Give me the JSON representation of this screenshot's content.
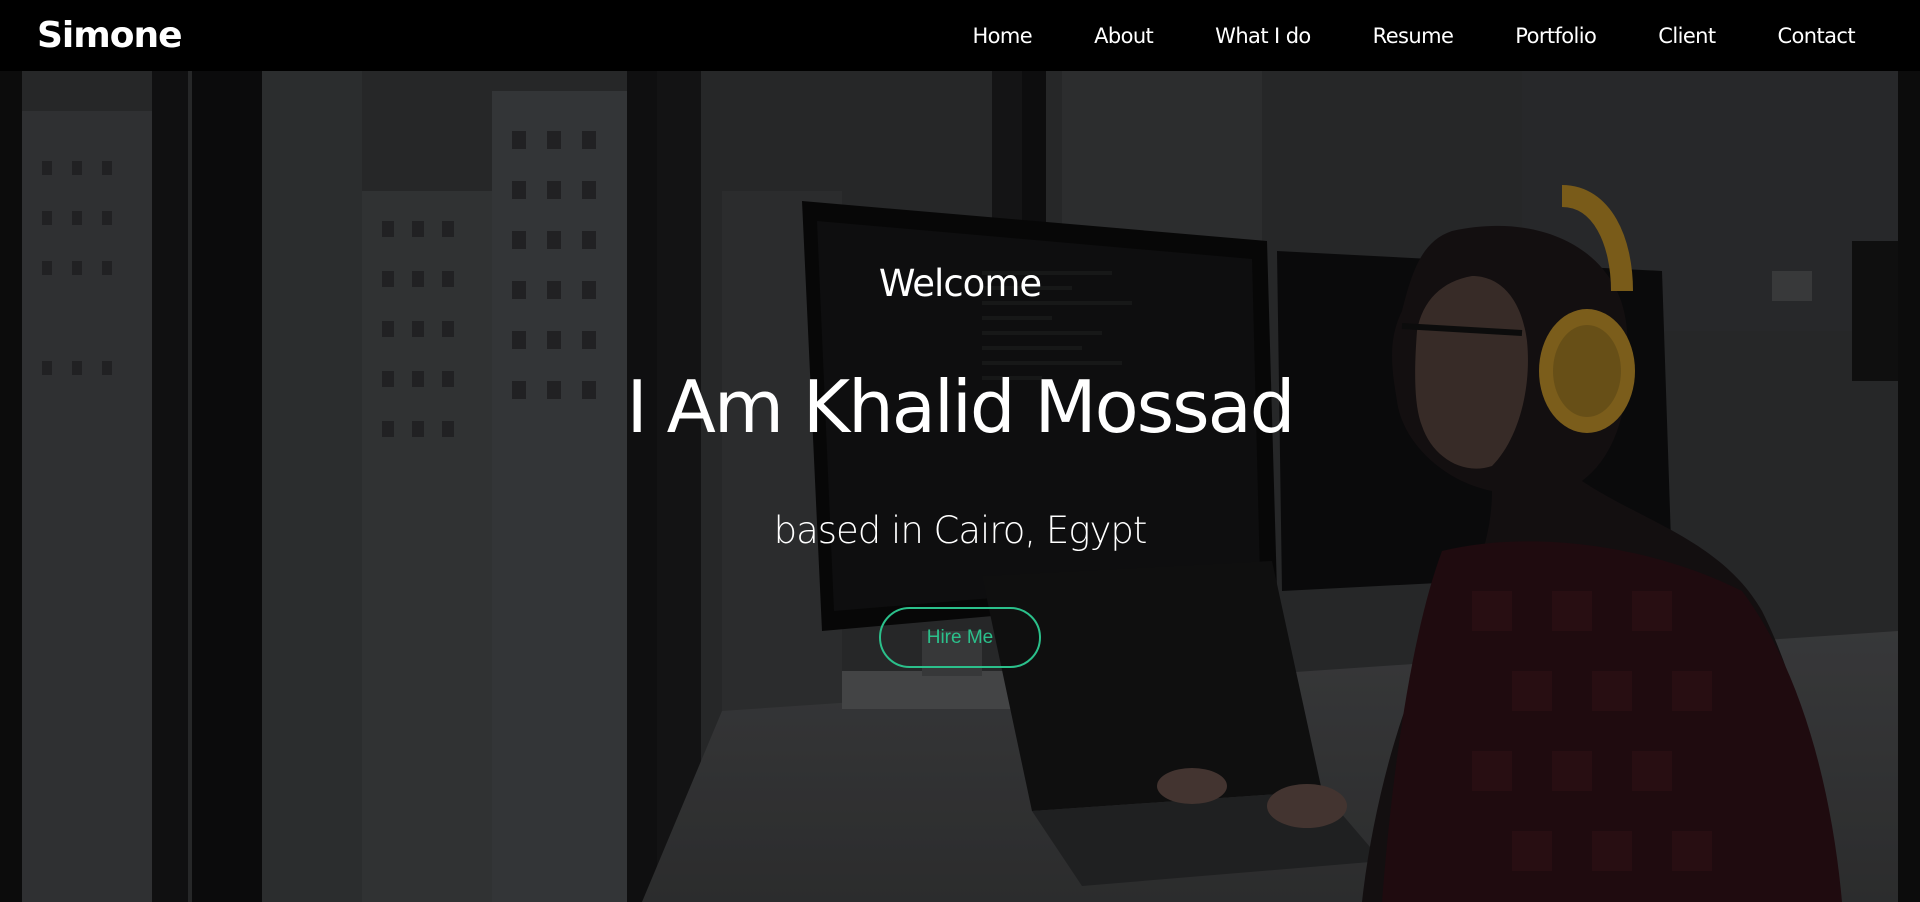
{
  "header": {
    "brand": "Simone",
    "nav": [
      {
        "label": "Home"
      },
      {
        "label": "About"
      },
      {
        "label": "What I do"
      },
      {
        "label": "Resume"
      },
      {
        "label": "Portfolio"
      },
      {
        "label": "Client"
      },
      {
        "label": "Contact"
      }
    ]
  },
  "hero": {
    "welcome": "Welcome",
    "title": "I Am Khalid Mossad",
    "subtitle": "based in Cairo, Egypt",
    "cta_label": "Hire Me"
  },
  "colors": {
    "navbar_bg": "#000000",
    "text": "#ffffff",
    "accent": "#2bc08b"
  }
}
